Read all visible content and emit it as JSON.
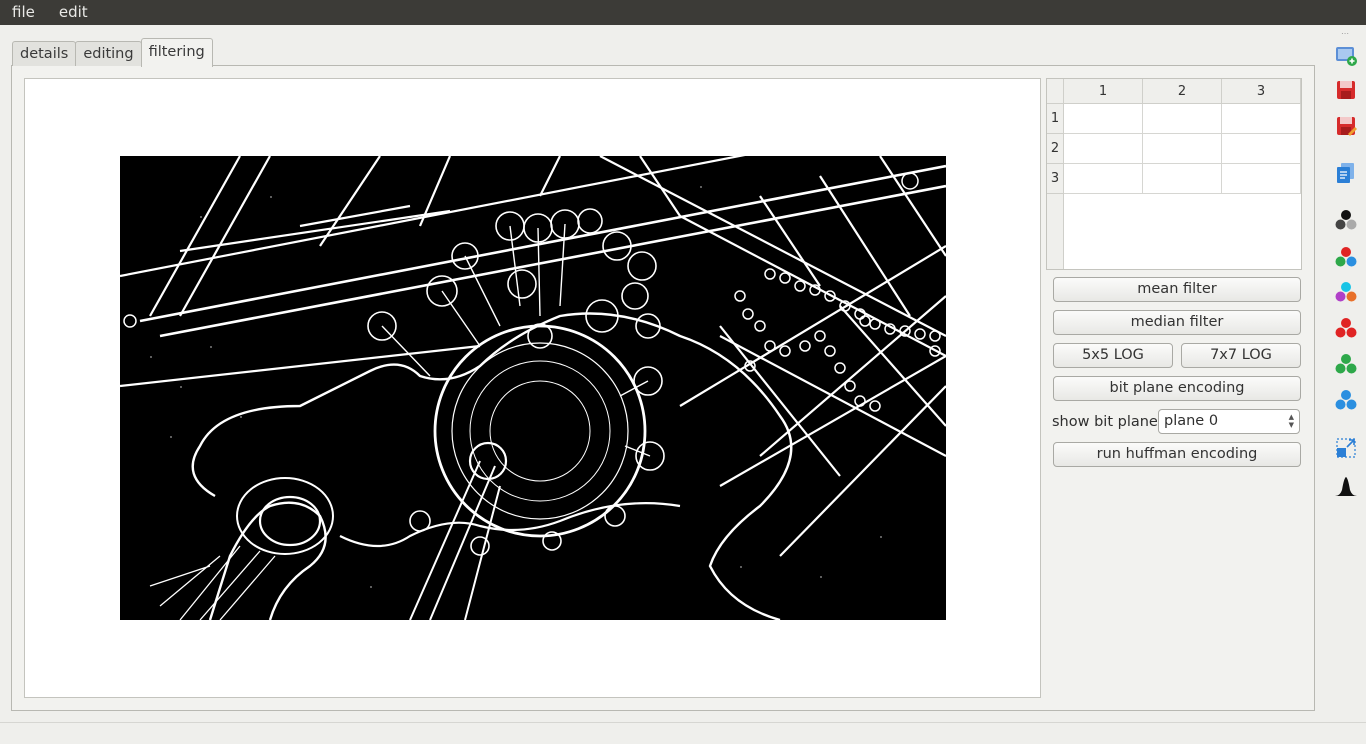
{
  "menu": {
    "items": [
      "file",
      "edit"
    ]
  },
  "tabs": [
    {
      "label": "details"
    },
    {
      "label": "editing"
    },
    {
      "label": "filtering"
    }
  ],
  "active_tab": "filtering",
  "kernel_table": {
    "columns": [
      "1",
      "2",
      "3"
    ],
    "rows": [
      "1",
      "2",
      "3"
    ],
    "cells": [
      [
        "",
        "",
        ""
      ],
      [
        "",
        "",
        ""
      ],
      [
        "",
        "",
        ""
      ]
    ]
  },
  "buttons": {
    "mean_filter": "mean filter",
    "median_filter": "median filter",
    "log5": "5x5 LOG",
    "log7": "7x7 LOG",
    "bit_plane_encoding": "bit plane encoding",
    "run_huffman": "run huffman encoding"
  },
  "bit_plane": {
    "label": "show bit plane",
    "selected": "plane 0"
  },
  "toolbar_icons": [
    "add-image-icon",
    "save-icon",
    "save-as-icon",
    "copy-document-icon",
    "grayscale-icon",
    "rgb-channels-icon",
    "cmy-channels-icon",
    "red-channel-icon",
    "green-channel-icon",
    "blue-channel-icon",
    "resize-icon",
    "histogram-icon"
  ],
  "colors": {
    "menubar": "#3c3b37",
    "red": "#e02424",
    "green": "#2ea84a",
    "blue": "#2b8fe0",
    "cyan": "#19c4e6",
    "magenta": "#b040c8"
  }
}
